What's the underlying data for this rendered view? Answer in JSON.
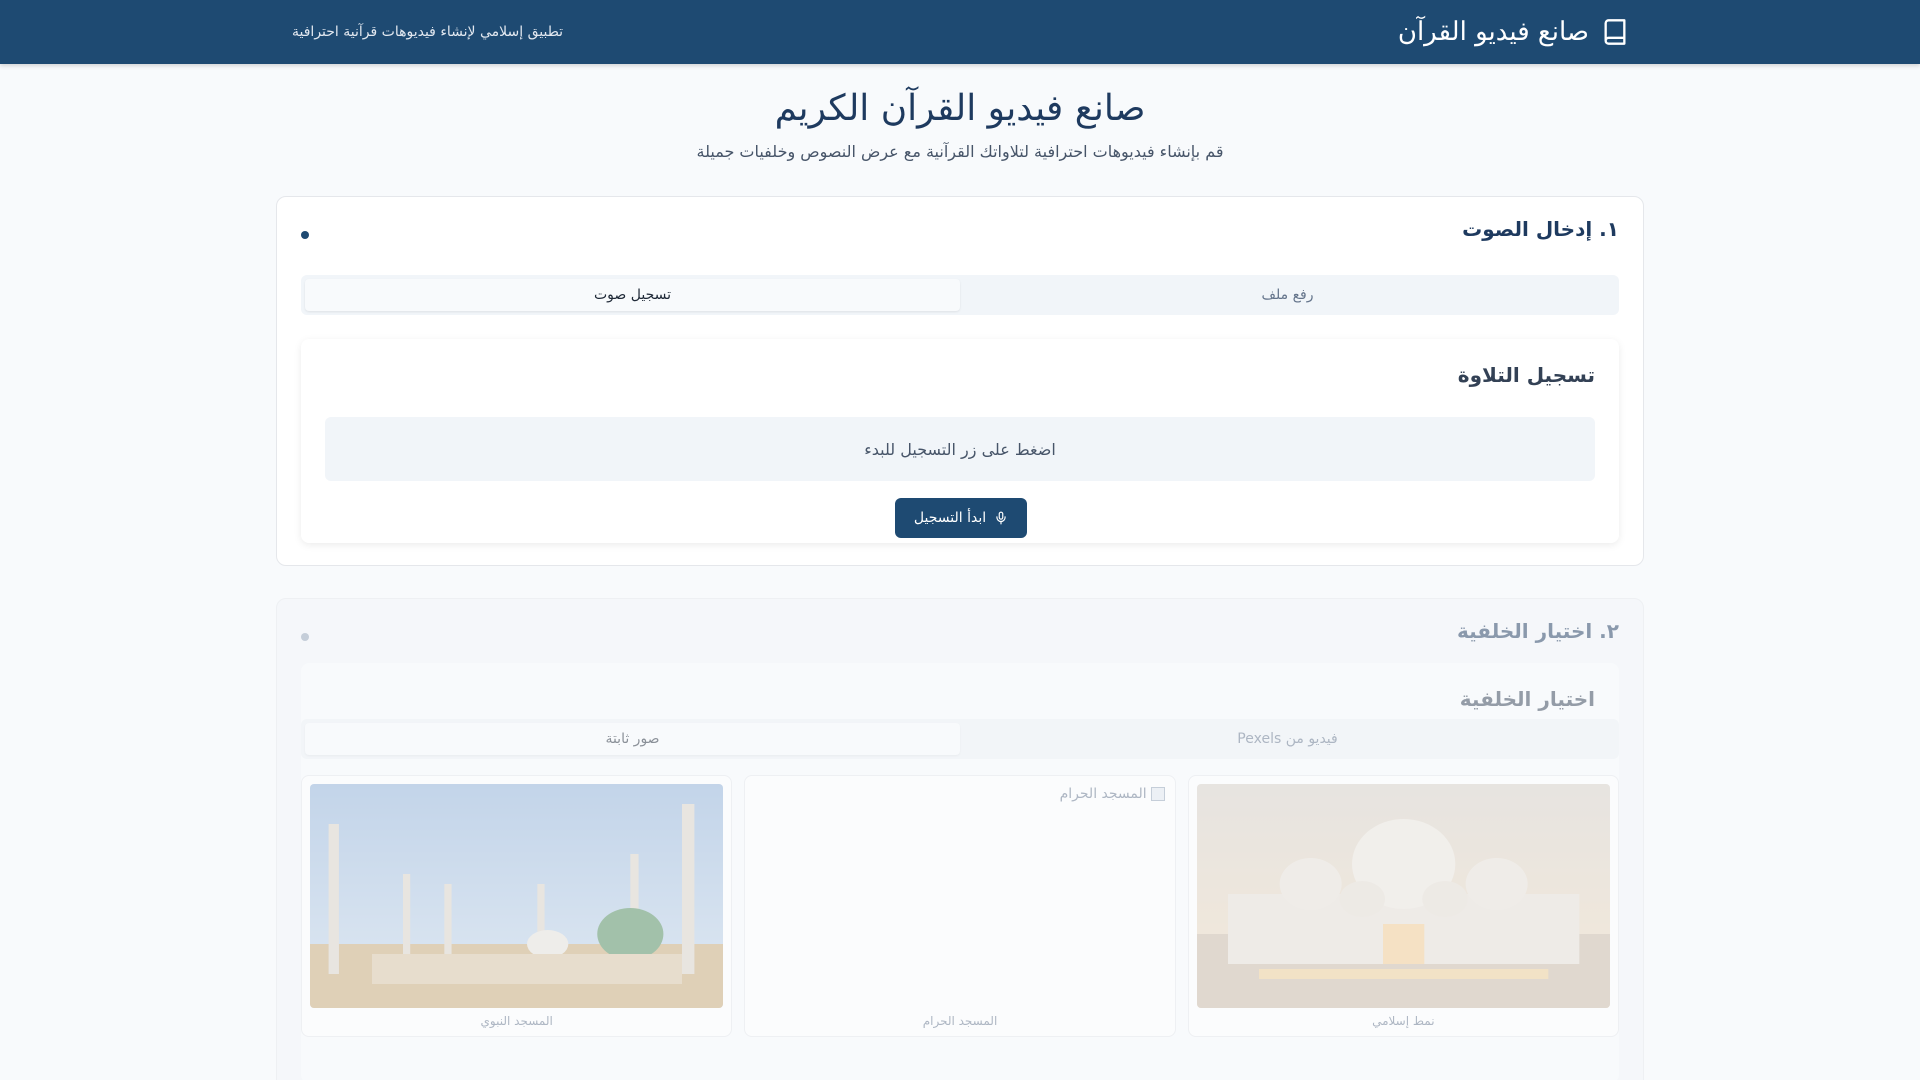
{
  "header": {
    "app_title": "صانع فيديو القرآن",
    "tagline": "تطبيق إسلامي لإنشاء فيديوهات قرآنية احترافية",
    "icon": "book-icon"
  },
  "hero": {
    "title": "صانع فيديو القرآن الكريم",
    "subtitle": "قم بإنشاء فيديوهات احترافية لتلاواتك القرآنية مع عرض النصوص وخلفيات جميلة"
  },
  "audio_section": {
    "title": "١. إدخال الصوت",
    "tabs": [
      {
        "label": "رفع ملف",
        "active": false
      },
      {
        "label": "تسجيل صوت",
        "active": true
      }
    ],
    "recording": {
      "title": "تسجيل التلاوة",
      "status": "اضغط على زر التسجيل للبدء",
      "start_button": "ابدأ التسجيل",
      "button_icon": "microphone-icon"
    }
  },
  "background_section": {
    "title": "٢. اختيار الخلفية",
    "inner_title": "اختيار الخلفية",
    "tabs": [
      {
        "label": "فيديو من Pexels",
        "active": false
      },
      {
        "label": "صور ثابتة",
        "active": true
      }
    ],
    "images": [
      {
        "caption": "نمط إسلامي",
        "alt": ""
      },
      {
        "caption": "المسجد الحرام",
        "alt": "المسجد الحرام"
      },
      {
        "caption": "المسجد النبوي",
        "alt": ""
      }
    ]
  },
  "colors": {
    "primary": "#1e4a72",
    "background": "#f8fafc"
  }
}
